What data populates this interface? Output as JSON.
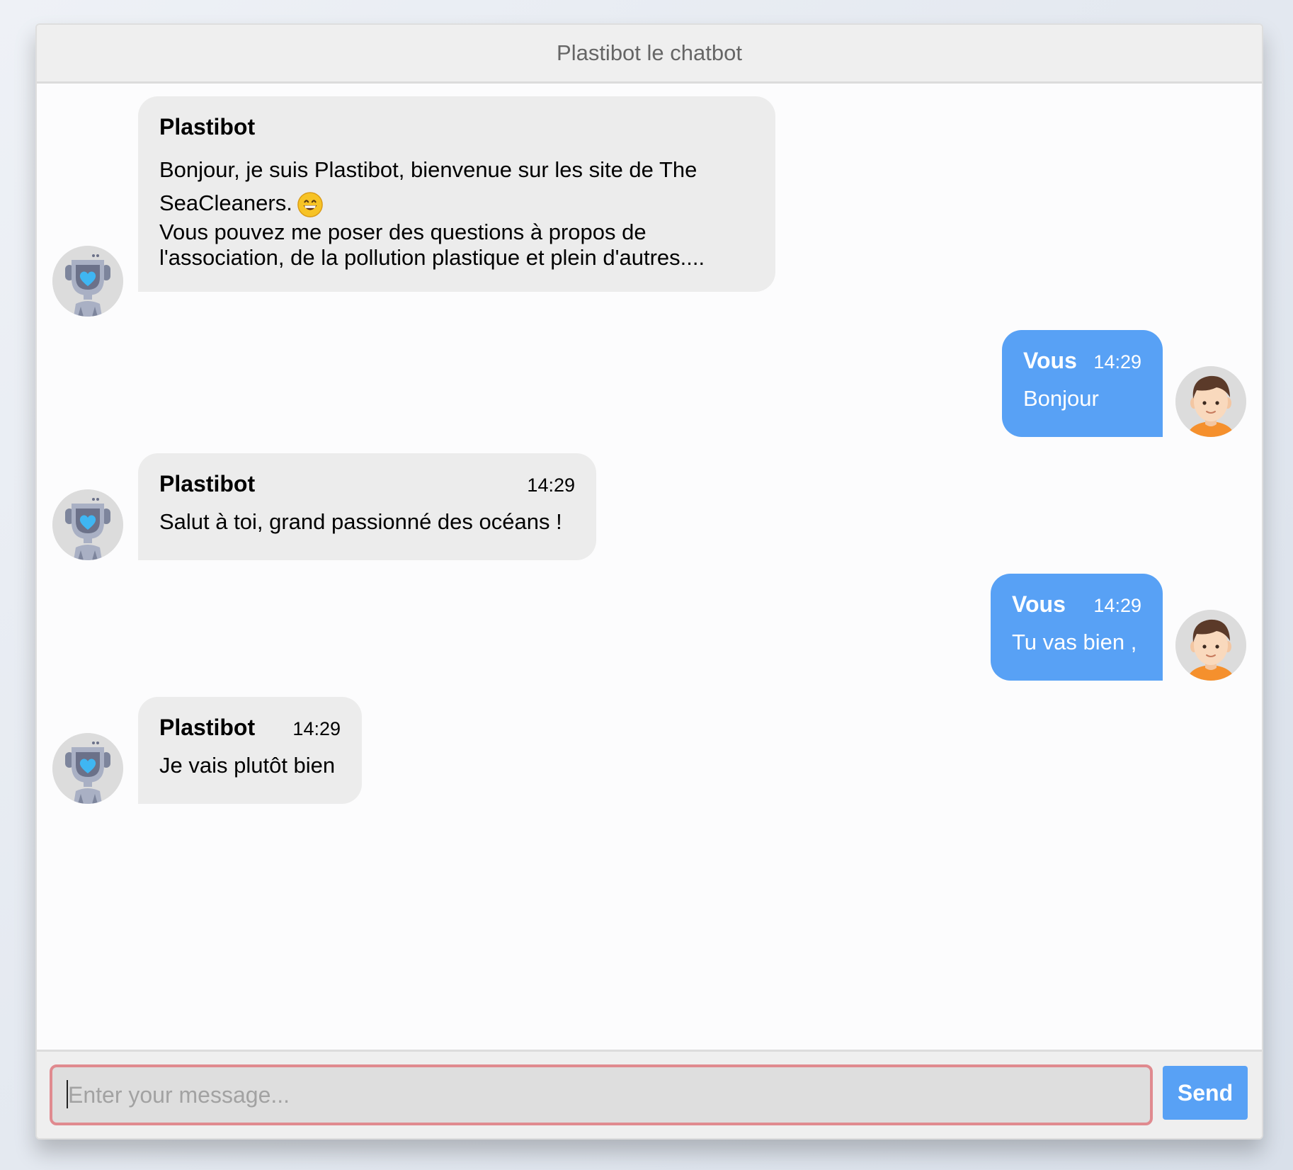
{
  "header": {
    "title": "Plastibot le chatbot"
  },
  "messages": [
    {
      "role": "bot",
      "sender": "Plastibot",
      "time": "",
      "lines": [
        "Bonjour, je suis Plastibot, bienvenue sur les site de The",
        "SeaCleaners.",
        "Vous pouvez me poser des questions à propos de",
        "l'association, de la pollution plastique et plein d'autres...."
      ],
      "emoji": "grinning-face-emoji"
    },
    {
      "role": "user",
      "sender": "Vous",
      "time": "14:29",
      "lines": [
        "Bonjour"
      ]
    },
    {
      "role": "bot",
      "sender": "Plastibot",
      "time": "14:29",
      "lines": [
        "Salut à toi, grand passionné des océans !"
      ]
    },
    {
      "role": "user",
      "sender": "Vous",
      "time": "14:29",
      "lines": [
        "Tu vas bien ,"
      ]
    },
    {
      "role": "bot",
      "sender": "Plastibot",
      "time": "14:29",
      "lines": [
        "Je vais plutôt bien"
      ]
    }
  ],
  "composer": {
    "placeholder": "Enter your message...",
    "value": "",
    "send_label": "Send"
  },
  "colors": {
    "user_bubble": "#58a1f5",
    "bot_bubble": "#ececec",
    "input_border": "#e08a8f",
    "send_button": "#58a1f5"
  },
  "icons": {
    "bot_avatar": "robot-avatar-icon",
    "user_avatar": "user-avatar-icon"
  }
}
